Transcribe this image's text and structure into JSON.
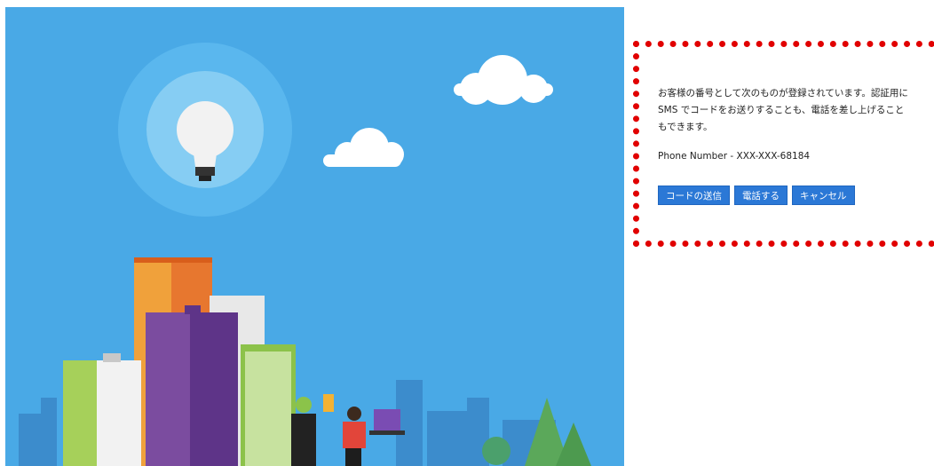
{
  "verification": {
    "message": "お客様の番号として次のものが登録されています。認証用に SMS でコードをお送りすることも、電話を差し上げることもできます。",
    "phone_label": "Phone Number - XXX-XXX-68184",
    "send_code_label": "コードの送信",
    "call_label": "電話する",
    "cancel_label": "キャンセル"
  },
  "colors": {
    "sky": "#49a9e6",
    "button": "#2b78d6",
    "border": "#e10000"
  }
}
